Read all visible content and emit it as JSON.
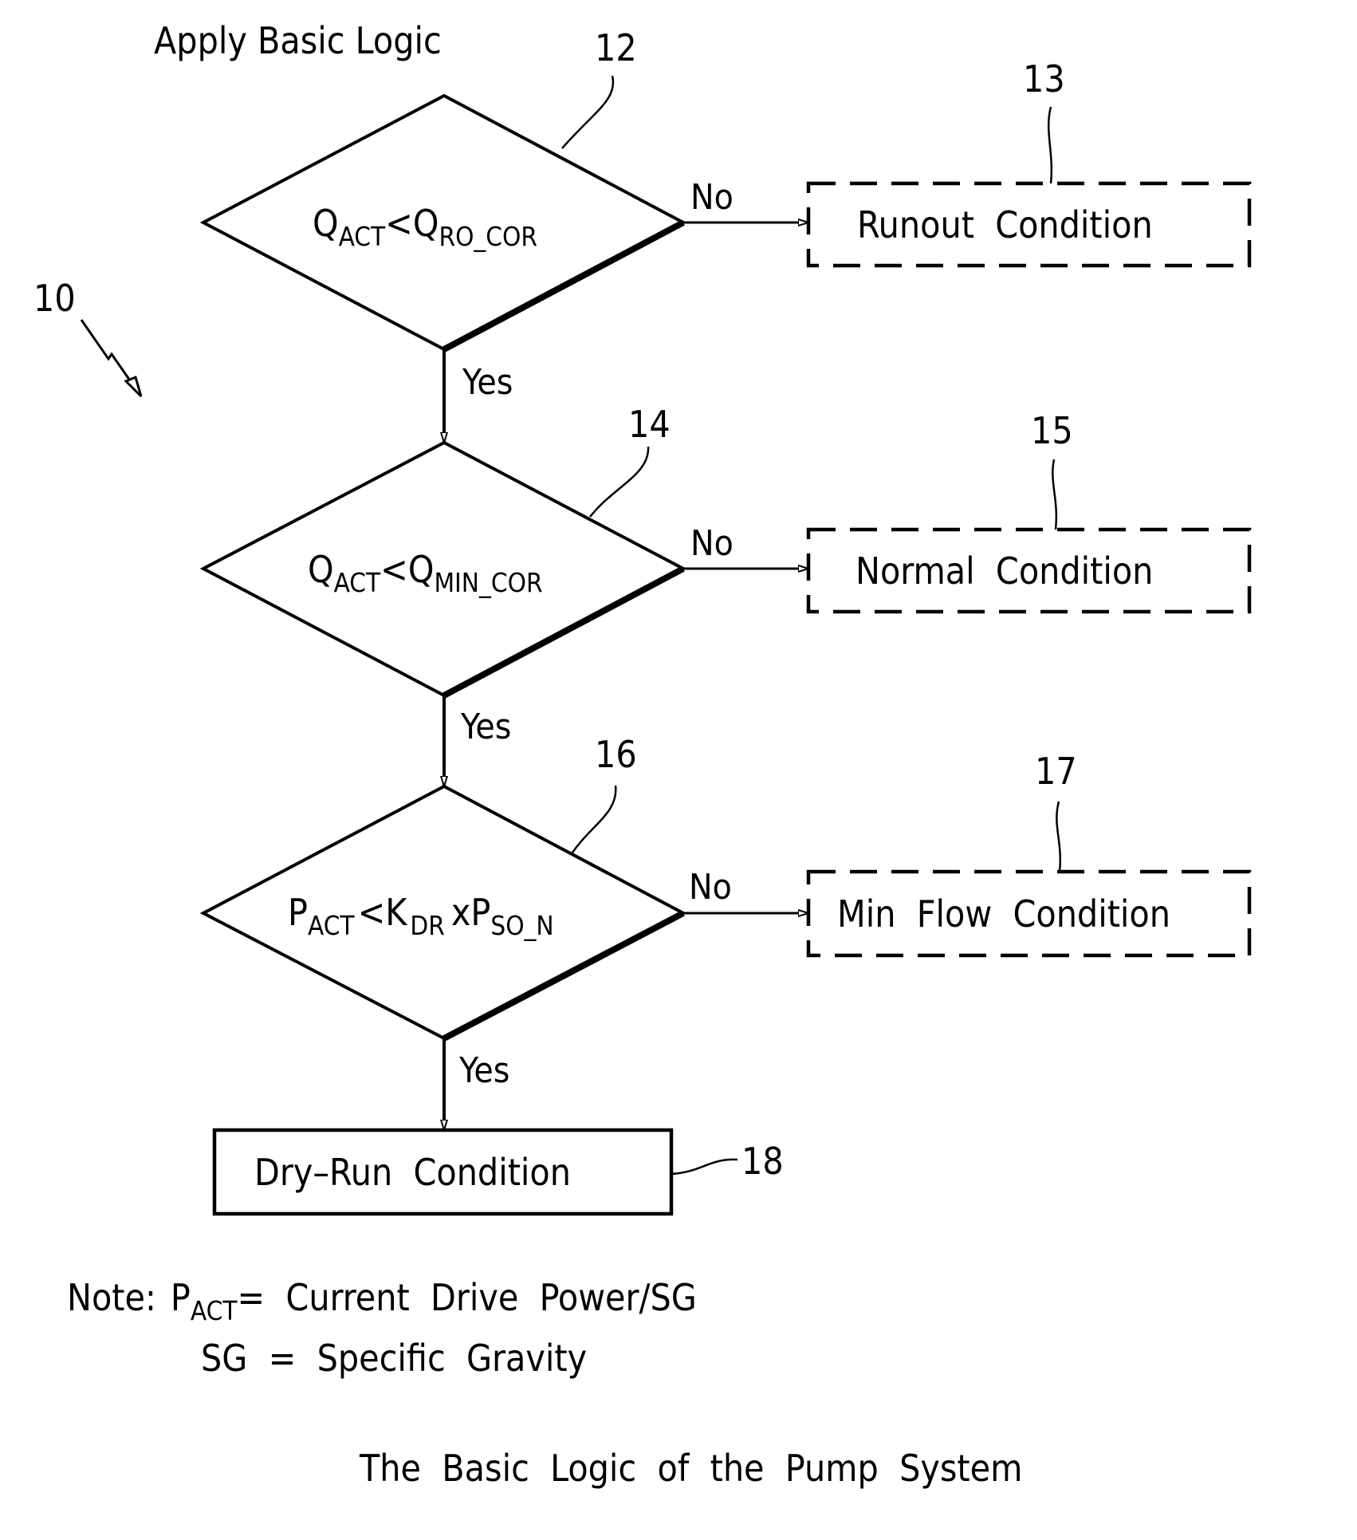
{
  "title": "Apply Basic Logic",
  "figure_ref": "10",
  "decisions": [
    {
      "ref": "12",
      "main1": "Q",
      "sub1": "ACT",
      "op": "<",
      "main2": "Q",
      "sub2": "RO_COR",
      "no_label": "No",
      "yes_label": "Yes"
    },
    {
      "ref": "14",
      "main1": "Q",
      "sub1": "ACT",
      "op": "<",
      "main2": "Q",
      "sub2": "MIN_COR",
      "no_label": "No",
      "yes_label": "Yes"
    },
    {
      "ref": "16",
      "main1": "P",
      "sub1": "ACT",
      "op": "<",
      "main2": "K",
      "sub2": "DR",
      "op2": "x",
      "main3": "P",
      "sub3": "SO_N",
      "no_label": "No",
      "yes_label": "Yes"
    }
  ],
  "outcomes": [
    {
      "ref": "13",
      "label": "Runout  Condition",
      "style": "dashed"
    },
    {
      "ref": "15",
      "label": "Normal  Condition",
      "style": "dashed"
    },
    {
      "ref": "17",
      "label": "Min  Flow  Condition",
      "style": "dashed"
    },
    {
      "ref": "18",
      "label": "Dry–Run  Condition",
      "style": "solid"
    }
  ],
  "note": {
    "prefix": "Note:",
    "symbol": "P",
    "symbol_sub": "ACT",
    "definition": "=  Current  Drive  Power/SG",
    "line2": "SG  =  Specific  Gravity"
  },
  "caption": "The  Basic  Logic  of  the  Pump  System"
}
